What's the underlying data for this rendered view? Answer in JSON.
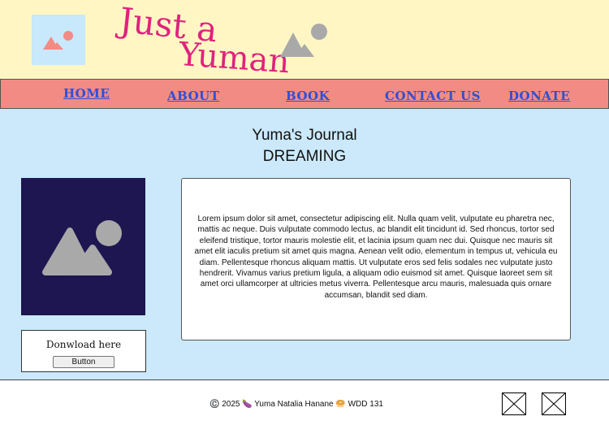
{
  "header": {
    "title_line1": "Just a",
    "title_line2": "Yuman"
  },
  "nav": {
    "home": "HOME",
    "about": "ABOUT",
    "book": "BOOK",
    "contact": "CONTACT US",
    "donate": "DONATE"
  },
  "main": {
    "title": "Yuma's Journal",
    "subtitle": "DREAMING",
    "download_label": "Donwload here",
    "download_button": "Button",
    "article": "Lorem ipsum dolor sit amet, consectetur adipiscing elit. Nulla quam velit, vulputate eu pharetra nec, mattis ac neque. Duis vulputate commodo lectus, ac blandit elit tincidunt id. Sed rhoncus, tortor sed eleifend tristique, tortor mauris molestie elit, et lacinia ipsum quam nec dui. Quisque nec mauris sit amet elit iaculis pretium sit amet quis magna. Aenean velit odio, elementum in tempus ut, vehicula eu diam. Pellentesque rhoncus aliquam mattis. Ut vulputate eros sed felis sodales nec vulputate justo hendrerit. Vivamus varius pretium ligula, a aliquam odio euismod sit amet. Quisque laoreet sem sit amet orci ullamcorper at ultricies metus viverra. Pellentesque arcu mauris, malesuada quis ornare accumsan, blandit sed diam."
  },
  "footer": {
    "text": "©️ 2025 🍆 Yuma Natalia Hanane 🥯 WDD 131"
  },
  "icons": {
    "logo": "image-placeholder-icon",
    "header_image": "mountain-sun-icon",
    "feature": "image-placeholder-icon",
    "social": [
      "social-icon-placeholder",
      "social-icon-placeholder"
    ]
  },
  "colors": {
    "header_bg": "#fff6c3",
    "nav_bg": "#f28b84",
    "page_bg": "#cbe9fa",
    "title_pink": "#e0227d",
    "link_blue": "#2e4fd6",
    "feature_bg": "#1e1650"
  }
}
